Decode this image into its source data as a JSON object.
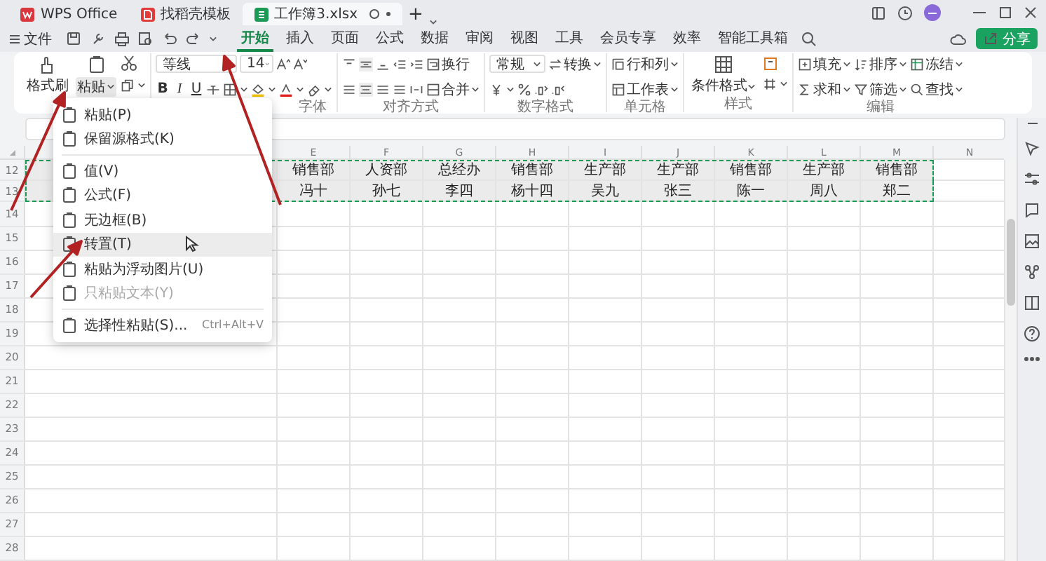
{
  "title_bar": {
    "tabs": [
      {
        "label": "WPS Office",
        "kind": "app",
        "selected": false
      },
      {
        "label": "找稻壳模板",
        "kind": "template",
        "selected": false
      },
      {
        "label": "工作簿3.xlsx",
        "kind": "sheet",
        "selected": true
      }
    ],
    "new_tab": "+"
  },
  "menu_bar": {
    "file": "文件",
    "tabs": [
      {
        "label": "开始",
        "selected": true
      },
      {
        "label": "插入",
        "selected": false
      },
      {
        "label": "页面",
        "selected": false
      },
      {
        "label": "公式",
        "selected": false
      },
      {
        "label": "数据",
        "selected": false
      },
      {
        "label": "审阅",
        "selected": false
      },
      {
        "label": "视图",
        "selected": false
      },
      {
        "label": "工具",
        "selected": false
      },
      {
        "label": "会员专享",
        "selected": false
      },
      {
        "label": "效率",
        "selected": false
      },
      {
        "label": "智能工具箱",
        "selected": false
      }
    ],
    "share": "分享"
  },
  "ribbon": {
    "clipboard": {
      "format_painter": "格式刷",
      "paste": "粘贴"
    },
    "font": {
      "name": "等线",
      "size": "14",
      "styles": [
        "B",
        "I",
        "U"
      ],
      "label": "字体"
    },
    "alignment": {
      "wrap": "换行",
      "merge": "合并",
      "label": "对齐方式"
    },
    "number": {
      "format": "常规",
      "convert": "转换",
      "label": "数字格式"
    },
    "cells": {
      "rows_columns": "行和列",
      "worksheet": "工作表",
      "label": "单元格"
    },
    "styles": {
      "conditional_format": "条件格式",
      "label": "样式"
    },
    "editing": {
      "fill": "填充",
      "sort": "排序",
      "freeze": "冻结",
      "sum": "求和",
      "filter": "筛选",
      "find": "查找",
      "label": "编辑"
    }
  },
  "sheet": {
    "columns": [
      "E",
      "F",
      "G",
      "H",
      "I",
      "J",
      "K",
      "L",
      "M",
      "N"
    ],
    "rows": [
      {
        "number": "12",
        "copied": true,
        "cells": [
          "销售部",
          "人资部",
          "总经办",
          "销售部",
          "生产部",
          "生产部",
          "销售部",
          "生产部",
          "销售部"
        ]
      },
      {
        "number": "13",
        "copied": true,
        "cells": [
          "冯十",
          "孙七",
          "李四",
          "杨十四",
          "吴九",
          "张三",
          "陈一",
          "周八",
          "郑二"
        ]
      },
      {
        "number": "14",
        "copied": false
      },
      {
        "number": "15",
        "copied": false
      },
      {
        "number": "16",
        "copied": false
      },
      {
        "number": "17",
        "copied": false
      },
      {
        "number": "18",
        "copied": false
      },
      {
        "number": "19",
        "copied": false
      },
      {
        "number": "20",
        "copied": false
      },
      {
        "number": "21",
        "copied": false
      },
      {
        "number": "22",
        "copied": false
      },
      {
        "number": "23",
        "copied": false
      },
      {
        "number": "24",
        "copied": false
      },
      {
        "number": "25",
        "copied": false
      },
      {
        "number": "26",
        "copied": false
      },
      {
        "number": "27",
        "copied": false
      },
      {
        "number": "28",
        "copied": false
      }
    ]
  },
  "paste_menu": {
    "items": [
      {
        "kind": "item",
        "label": "粘贴(P)",
        "hovered": false,
        "disabled": false
      },
      {
        "kind": "item",
        "label": "保留源格式(K)",
        "hovered": false,
        "disabled": false
      },
      {
        "kind": "divider"
      },
      {
        "kind": "item",
        "label": "值(V)",
        "hovered": false,
        "disabled": false
      },
      {
        "kind": "item",
        "label": "公式(F)",
        "hovered": false,
        "disabled": false
      },
      {
        "kind": "item",
        "label": "无边框(B)",
        "hovered": false,
        "disabled": false
      },
      {
        "kind": "item",
        "label": "转置(T)",
        "hovered": true,
        "disabled": false
      },
      {
        "kind": "item",
        "label": "粘贴为浮动图片(U)",
        "hovered": false,
        "disabled": false
      },
      {
        "kind": "item",
        "label": "只粘贴文本(Y)",
        "hovered": false,
        "disabled": true
      },
      {
        "kind": "divider"
      },
      {
        "kind": "item",
        "label": "选择性粘贴(S)...",
        "shortcut": "Ctrl+Alt+V",
        "hovered": false,
        "disabled": false
      }
    ]
  }
}
